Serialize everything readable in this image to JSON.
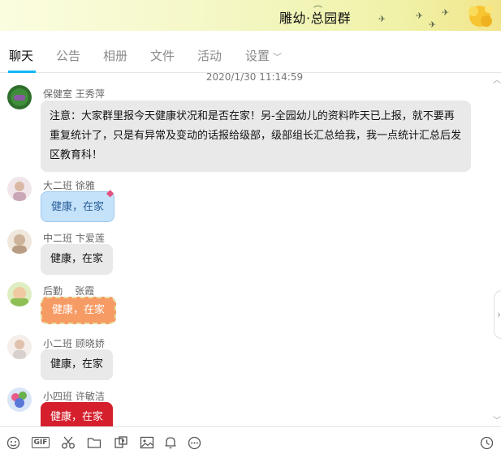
{
  "window": {
    "title": "雕幼·总园群"
  },
  "tabs": [
    {
      "label": "聊天"
    },
    {
      "label": "公告"
    },
    {
      "label": "相册"
    },
    {
      "label": "文件"
    },
    {
      "label": "活动"
    },
    {
      "label": "设置"
    }
  ],
  "chat": {
    "timestamp": "2020/1/30 11:14:59",
    "messages": [
      {
        "sender": "保健室 王秀萍",
        "text": "注意：大家群里报今天健康状况和是否在家！另-全园幼儿的资料昨天已上报，就不要再重复统计了，只是有异常及变动的话报给级部，级部组长汇总给我，我一点统计汇总后发区教育科！"
      },
      {
        "sender": "大二班 徐雅",
        "text": "健康，在家"
      },
      {
        "sender": "中二班 卞爱莲",
        "text": "健康，在家"
      },
      {
        "sender": "后勤    张霞",
        "text": "健康，在家"
      },
      {
        "sender": "小二班 顾晓娇",
        "text": "健康，在家"
      },
      {
        "sender": "小四班 许敏洁",
        "text": "健康，在家"
      }
    ]
  },
  "toolbar": {
    "icons": [
      "emoji-icon",
      "gif-icon",
      "scissors-icon",
      "folder-icon",
      "screenshot-icon",
      "image-icon",
      "bell-icon",
      "more-icon",
      "history-icon"
    ],
    "gif_label": "GIF"
  },
  "colors": {
    "accent": "#12b7f5",
    "bubble_gray": "#e9e9e9",
    "bubble_blue": "#c5e2fb",
    "bubble_orange": "#f79b64",
    "bubble_red": "#d51f2c"
  }
}
